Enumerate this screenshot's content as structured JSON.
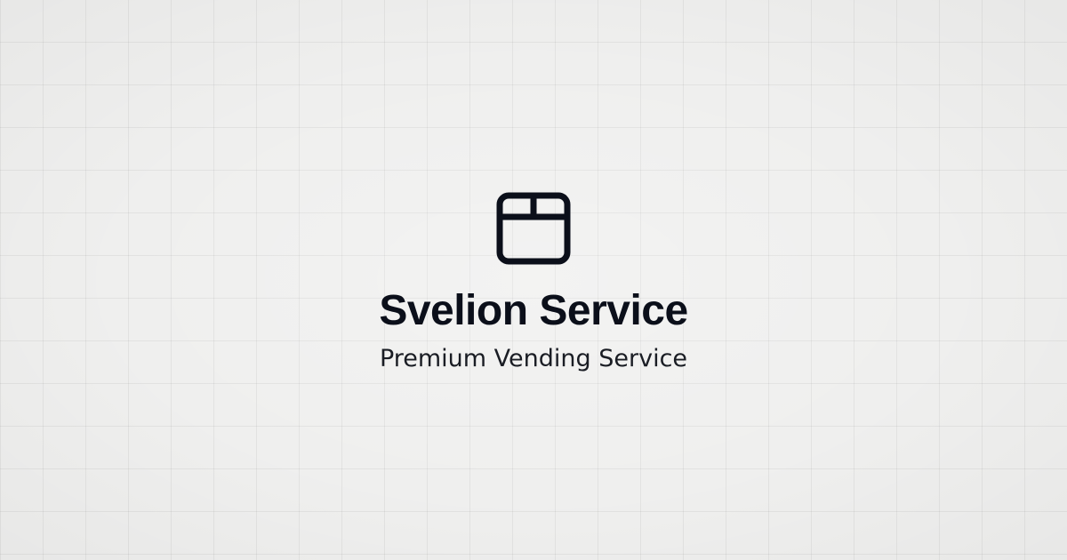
{
  "brand": {
    "title": "Svelion Service",
    "tagline": "Premium Vending Service",
    "icon": "package-box-icon",
    "text_color": "#0b0f1a",
    "background_color": "#efefee"
  }
}
